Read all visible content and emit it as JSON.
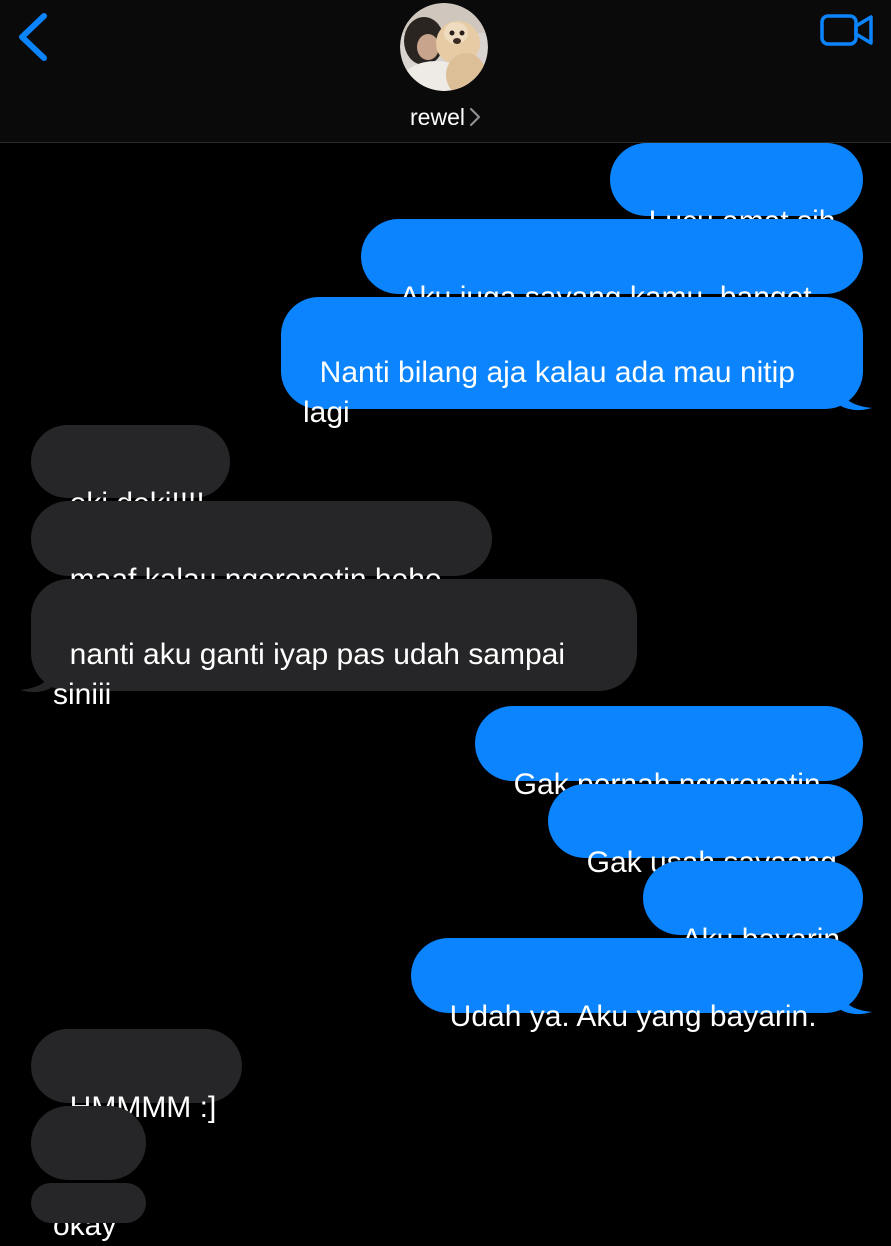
{
  "header": {
    "contact_name": "rewel",
    "back_icon": "chevron-left-icon",
    "video_icon": "video-camera-icon",
    "accent_color": "#0b84fe"
  },
  "messages": [
    {
      "direction": "sent",
      "text": "Lucu amat sih"
    },
    {
      "direction": "sent",
      "text": "Aku juga sayang kamu, banget"
    },
    {
      "direction": "sent",
      "text": "Nanti bilang aja kalau ada mau nitip\nlagi"
    },
    {
      "direction": "received",
      "text": "oki doki!!!!"
    },
    {
      "direction": "received",
      "text": "maaf kalau ngerepotin hehe"
    },
    {
      "direction": "received",
      "text": "nanti aku ganti iyap pas udah sampai\nsiniii"
    },
    {
      "direction": "sent",
      "text": "Gak pernah ngerepotin"
    },
    {
      "direction": "sent",
      "text": "Gak usah sayaang"
    },
    {
      "direction": "sent",
      "text": "Aku bayarin"
    },
    {
      "direction": "sent",
      "text": "Udah ya. Aku yang bayarin."
    },
    {
      "direction": "received",
      "text": "HMMMM :]"
    },
    {
      "direction": "received",
      "text": "okay"
    }
  ],
  "colors": {
    "sent_bubble": "#0b84fe",
    "received_bubble": "#262628",
    "background": "#000000"
  }
}
